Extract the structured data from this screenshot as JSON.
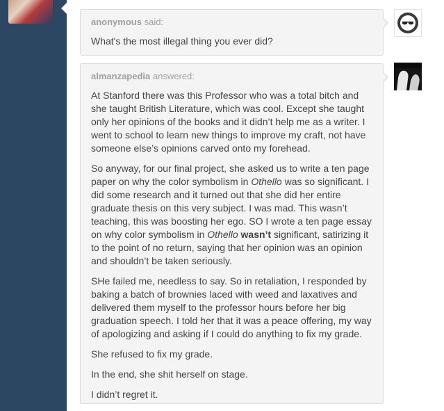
{
  "question": {
    "asker": "anonymous",
    "verb": "said:",
    "text": "What's the most illegal thing you ever did?"
  },
  "answer": {
    "answerer": "almanzapedia",
    "verb": "answered:",
    "p1": "At Stanford there was this Professor who was a total bitch and she taught British Literature, which was cool. Except she taught only her opinions of the books and it didn’t help me as a writer. I went to school to learn new things to improve my craft, not have someone else’s opinions carved onto my forehead.",
    "p2_a": "So anyway, for our final project, she asked us to write a ten page paper on why the color symbolism in ",
    "p2_othello1": "Othello",
    "p2_b": " was so significant. I did some research and it turned out that she did her entire graduate thesis on this very subject. I was mad. This wasn’t teaching, this was boosting her ego. SO I wrote a ten page essay on why color symbolism in ",
    "p2_othello2": "Othello",
    "p2_bold": "wasn’t",
    "p2_c": " significant, satirizing it to the point of no return, saying that her opinion was an opinion and shouldn’t be taken seriously.",
    "p3": "SHe failed me, needless to say. So in retaliation, I responded by baking a batch of brownies laced with weed and laxatives and delivered them myself to the professor hours before her big graduation speech. I told her that it was a peace offering, my way of apologizing and asking if I could do anything to fix my grade.",
    "p4": "She refused to fix my grade.",
    "p5": "In the end, she shit herself on stage.",
    "p6": "I didn’t regret it."
  },
  "icons": {
    "anon_avatar": "sunglasses-avatar-icon",
    "answerer_avatar": "photo-avatar",
    "poster_avatar": "comic-avatar"
  }
}
